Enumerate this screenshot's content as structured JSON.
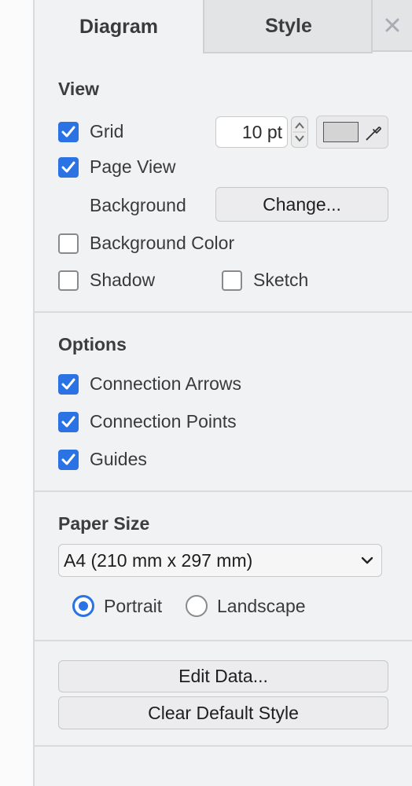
{
  "tabs": {
    "diagram": "Diagram",
    "style": "Style",
    "close_icon": "close-icon"
  },
  "view": {
    "title": "View",
    "grid_label": "Grid",
    "grid_checked": true,
    "grid_size": "10 pt",
    "grid_color": "#d4d4d4",
    "page_view_label": "Page View",
    "page_view_checked": true,
    "background_label": "Background",
    "change_button": "Change...",
    "background_color_label": "Background Color",
    "background_color_checked": false,
    "shadow_label": "Shadow",
    "shadow_checked": false,
    "sketch_label": "Sketch",
    "sketch_checked": false
  },
  "options": {
    "title": "Options",
    "connection_arrows_label": "Connection Arrows",
    "connection_arrows_checked": true,
    "connection_points_label": "Connection Points",
    "connection_points_checked": true,
    "guides_label": "Guides",
    "guides_checked": true
  },
  "paper": {
    "title": "Paper Size",
    "selected": "A4 (210 mm x 297 mm)",
    "portrait_label": "Portrait",
    "portrait_selected": true,
    "landscape_label": "Landscape",
    "landscape_selected": false
  },
  "actions": {
    "edit_data": "Edit Data...",
    "clear_default_style": "Clear Default Style"
  },
  "colors": {
    "accent": "#2b72e5",
    "panel": "#f1f2f4"
  }
}
